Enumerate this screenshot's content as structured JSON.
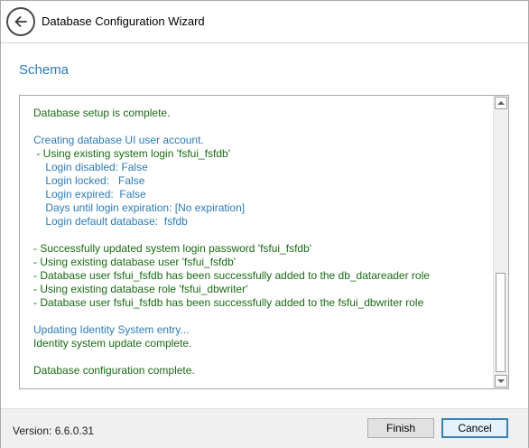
{
  "window": {
    "title": "Database Configuration Wizard"
  },
  "section": {
    "title": "Schema"
  },
  "log": {
    "lines": [
      {
        "text": "Database setup is complete.",
        "color": "green"
      },
      {
        "text": "",
        "color": "green"
      },
      {
        "text": "Creating database UI user account.",
        "color": "blue"
      },
      {
        "text": " - Using existing system login 'fsfui_fsfdb'",
        "color": "green"
      },
      {
        "text": "    Login disabled: False",
        "color": "blue"
      },
      {
        "text": "    Login locked:   False",
        "color": "blue"
      },
      {
        "text": "    Login expired:  False",
        "color": "blue"
      },
      {
        "text": "    Days until login expiration: [No expiration]",
        "color": "blue"
      },
      {
        "text": "    Login default database:  fsfdb",
        "color": "blue"
      },
      {
        "text": "",
        "color": "green"
      },
      {
        "text": "- Successfully updated system login password 'fsfui_fsfdb'",
        "color": "green"
      },
      {
        "text": "- Using existing database user 'fsfui_fsfdb'",
        "color": "green"
      },
      {
        "text": "- Database user fsfui_fsfdb has been successfully added to the db_datareader role",
        "color": "green"
      },
      {
        "text": "- Using existing database role 'fsfui_dbwriter'",
        "color": "green"
      },
      {
        "text": "- Database user fsfui_fsfdb has been successfully added to the fsfui_dbwriter role",
        "color": "green"
      },
      {
        "text": "",
        "color": "green"
      },
      {
        "text": "Updating Identity System entry...",
        "color": "blue"
      },
      {
        "text": "Identity system update complete.",
        "color": "green"
      },
      {
        "text": "",
        "color": "green"
      },
      {
        "text": "Database configuration complete.",
        "color": "green"
      }
    ]
  },
  "footer": {
    "version": "Version: 6.6.0.31",
    "finish_label": "Finish",
    "cancel_label": "Cancel"
  },
  "colors": {
    "accent": "#2e7bb8",
    "log_green": "#1a6b14",
    "log_blue": "#2e7bb8"
  },
  "icons": {
    "back": "back-arrow-icon",
    "scroll_up": "scroll-up-arrow-icon",
    "scroll_down": "scroll-down-arrow-icon"
  }
}
